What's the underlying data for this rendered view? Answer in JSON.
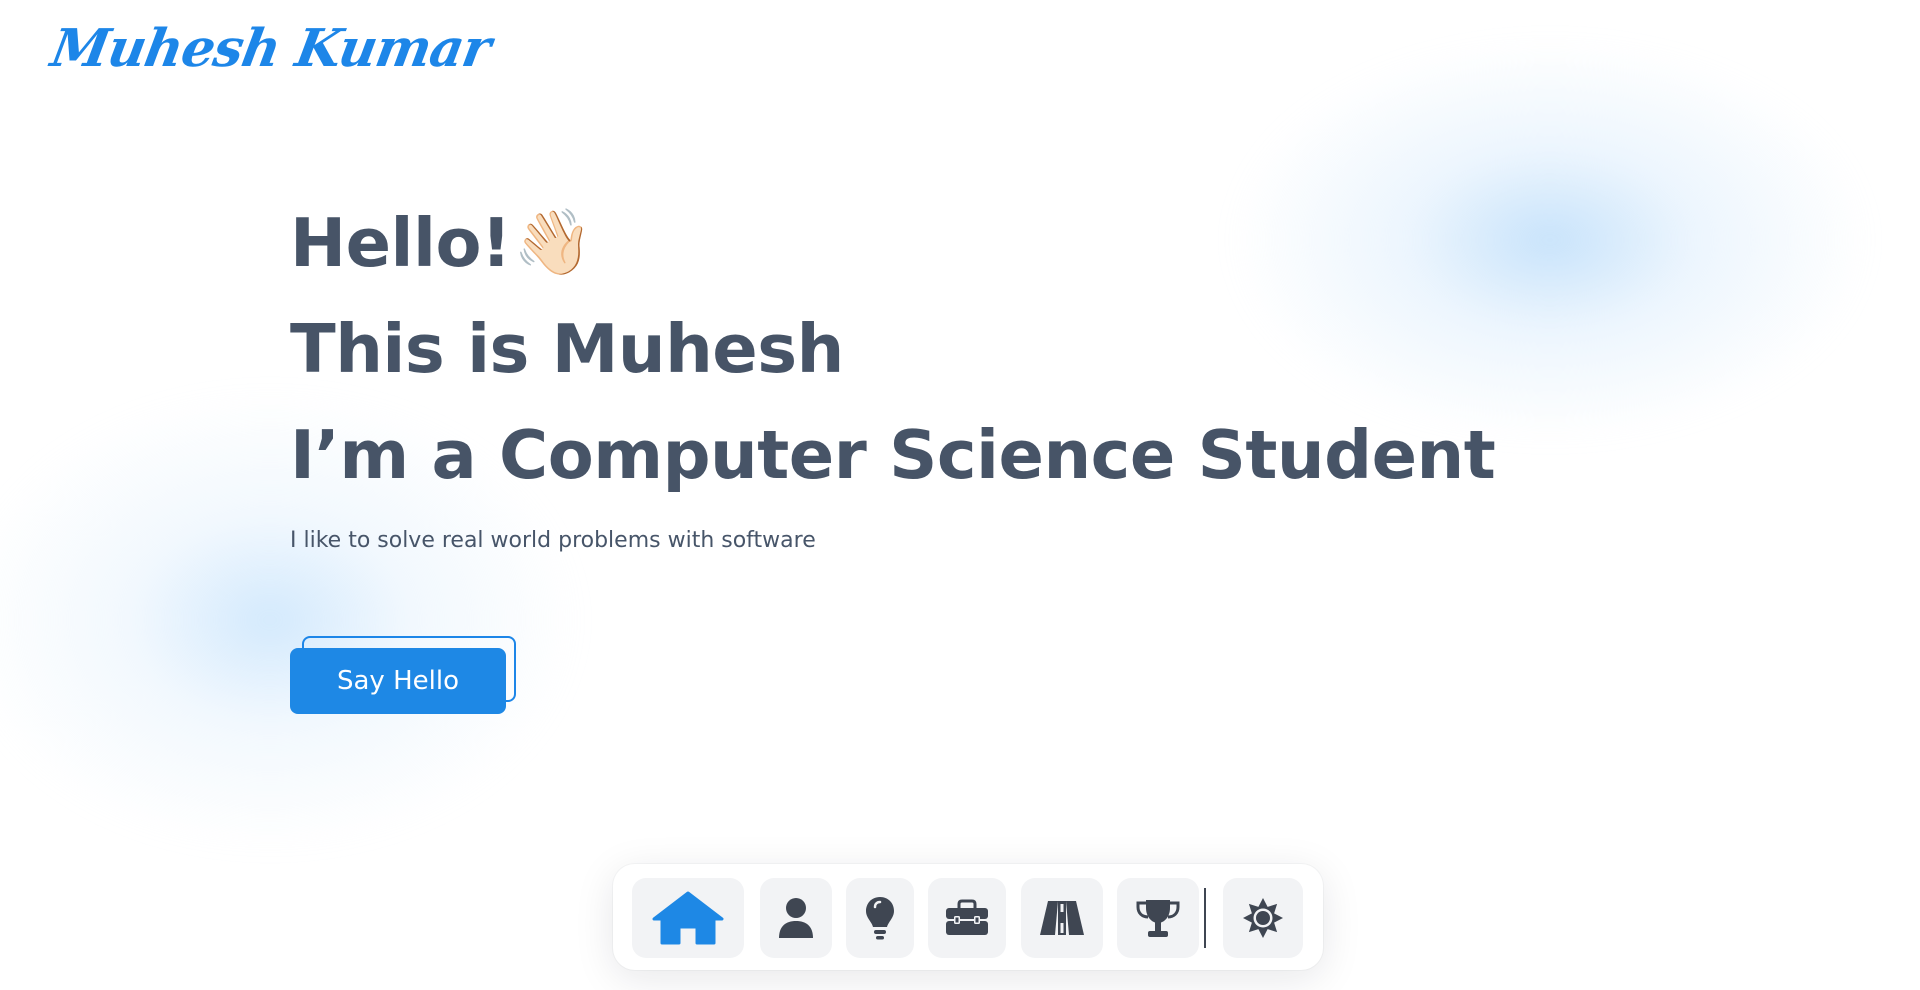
{
  "header": {
    "logo_text": "Muhesh Kumar",
    "logo_color": "#1d86e8"
  },
  "hero": {
    "greeting": "Hello!",
    "greeting_emoji": "👋🏻",
    "intro": "This is Muhesh",
    "role": "I’m a Computer Science Student",
    "tagline": "I like to solve real world problems with software",
    "cta_label": "Say Hello"
  },
  "colors": {
    "accent": "#1e88e5",
    "heading": "#475467",
    "dock_item_bg": "#f2f3f5",
    "icon_active": "#1e88e5",
    "icon_default": "#3f4652"
  },
  "dock": {
    "items": [
      {
        "icon": "home-icon",
        "active": true
      },
      {
        "icon": "user-icon",
        "active": false
      },
      {
        "icon": "lightbulb-icon",
        "active": false
      },
      {
        "icon": "toolbox-icon",
        "active": false
      },
      {
        "icon": "road-icon",
        "active": false
      },
      {
        "icon": "trophy-icon",
        "active": false
      },
      {
        "icon": "theme-toggle-sun-icon",
        "active": false
      }
    ]
  }
}
